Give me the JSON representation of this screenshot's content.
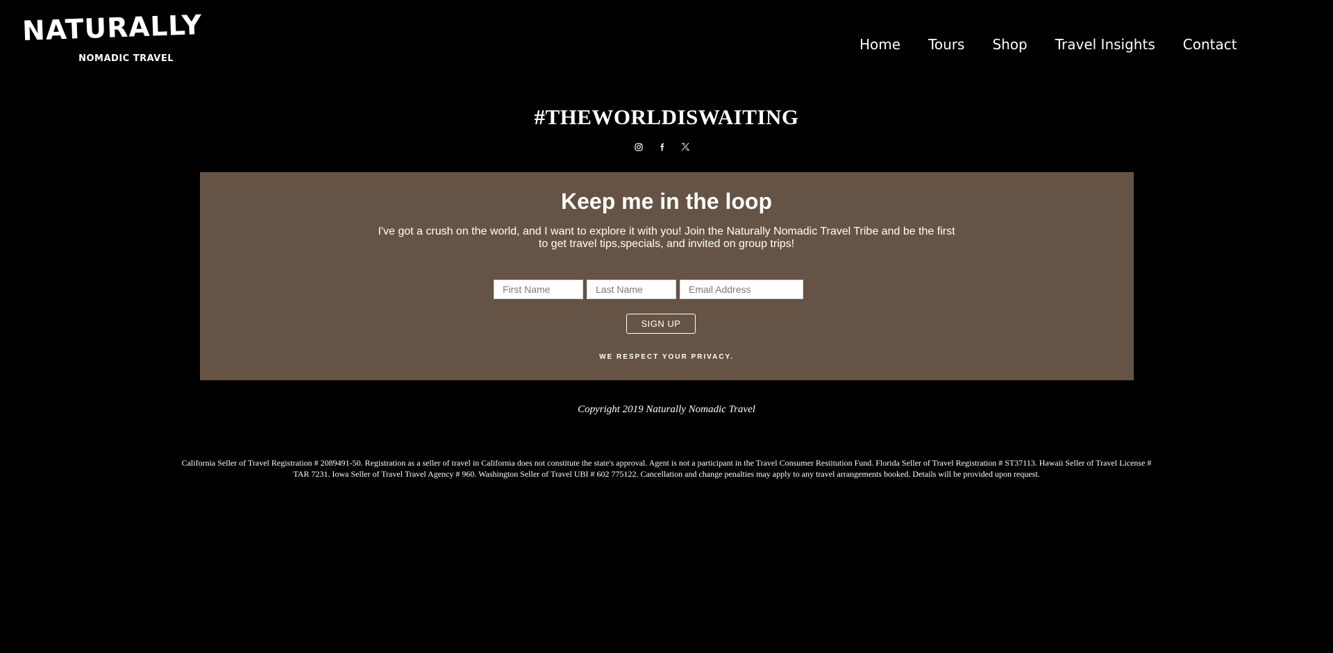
{
  "header": {
    "logo_main": "NATURALLY",
    "logo_sub": "NOMADIC TRAVEL",
    "nav": [
      {
        "label": "Home"
      },
      {
        "label": "Tours"
      },
      {
        "label": "Shop"
      },
      {
        "label": "Travel Insights"
      },
      {
        "label": "Contact"
      }
    ]
  },
  "hashtag": "#THEWORLDISWAITING",
  "social_icons": [
    "instagram-icon",
    "facebook-icon",
    "x-twitter-icon"
  ],
  "newsletter": {
    "title": "Keep me in the loop",
    "text": "I've got a crush on the world, and I want to explore it with you! Join the Naturally Nomadic Travel Tribe and be the first to get travel tips,specials, and invited on group trips!",
    "first_name_placeholder": "First Name",
    "last_name_placeholder": "Last Name",
    "email_placeholder": "Email Address",
    "button_label": "SIGN UP",
    "privacy": "WE RESPECT YOUR PRIVACY.",
    "background_color": "#655445"
  },
  "footer": {
    "copyright": "Copyright 2019 Naturally Nomadic Travel",
    "legal": "California Seller of Travel Registration # 2089491-50. Registration as a seller of travel in California does not constitute the state's approval. Agent is not a participant in the Travel Consumer Restitution Fund. Florida Seller of Travel Registration # ST37113. Hawaii Seller of Travel License # TAR 7231. Iowa Seller of Travel Travel Agency # 960. Washington Seller of Travel UBI # 602 775122. Cancellation and change penalties may apply to any travel arrangements booked. Details will be provided upon request."
  }
}
